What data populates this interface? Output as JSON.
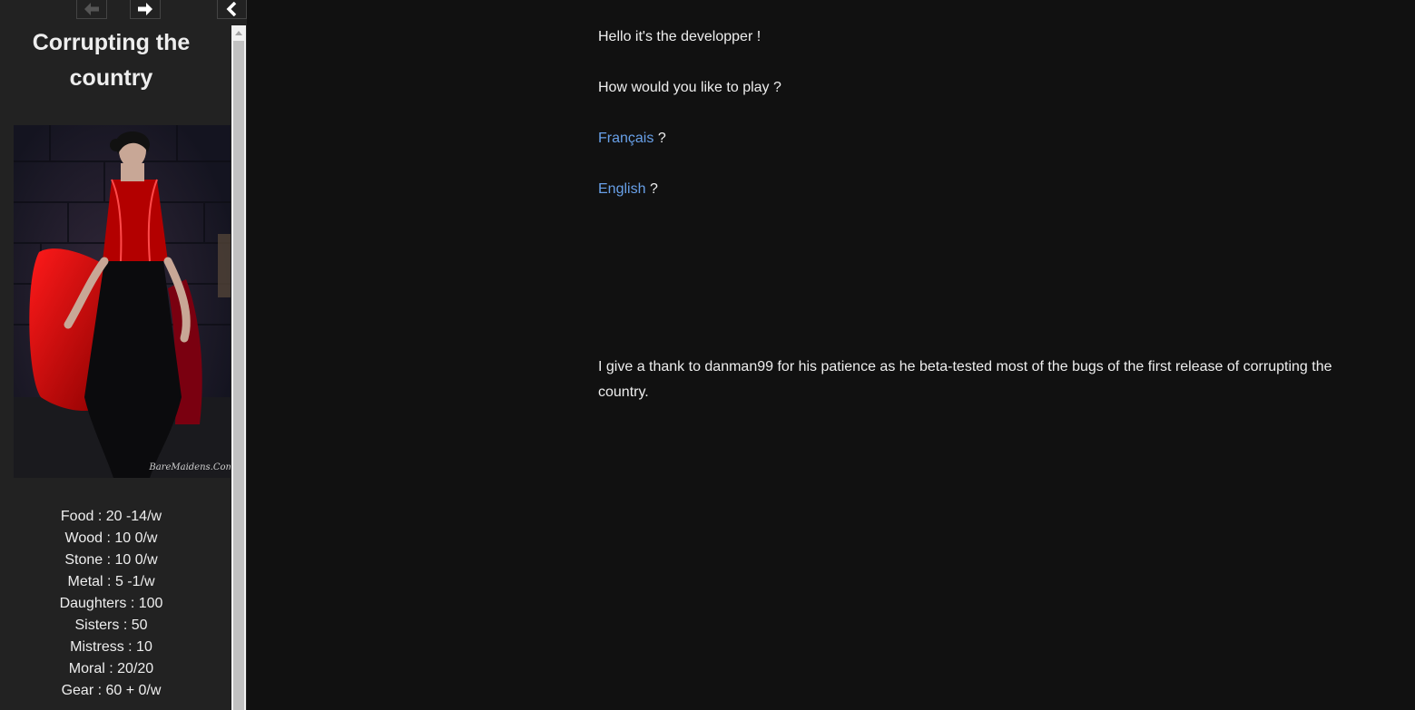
{
  "sidebar": {
    "title_line1": "Corrupting the",
    "title_line2": "country",
    "portrait_credit": "BareMaidens.Com",
    "stats": [
      "Food : 20 -14/w",
      "Wood : 10 0/w",
      "Stone : 10 0/w",
      "Metal : 5 -1/w",
      "Daughters : 100",
      "Sisters : 50",
      "Mistress : 10",
      "Moral : 20/20",
      "Gear : 60 + 0/w"
    ],
    "icons": {
      "back": "arrow-left-icon",
      "forward": "arrow-right-icon",
      "stow": "chevron-left-icon"
    }
  },
  "passage": {
    "greeting": "Hello it's the developper !",
    "question": "How would you like to play ?",
    "french_link": "Français",
    "english_link": "English",
    "question_mark": "?",
    "thanks": "I give a thank to danman99 for his patience as he beta-tested most of the bugs of the first release of corrupting the country."
  },
  "colors": {
    "page_background": "#111111",
    "sidebar_background": "#222222",
    "text": "#eeeeee",
    "link": "#68a0e8"
  }
}
